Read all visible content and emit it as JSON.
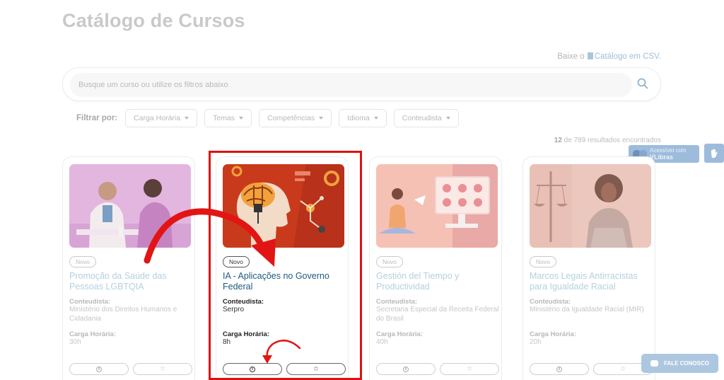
{
  "page": {
    "title": "Catálogo de Cursos"
  },
  "csv": {
    "prefix": "Baixe o",
    "link": "Catálogo em CSV."
  },
  "search": {
    "placeholder": "Busque um curso ou utilize os filtros abaixo"
  },
  "filters": {
    "label": "Filtrar por:",
    "items": [
      "Carga Horária",
      "Temas",
      "Competências",
      "Idioma",
      "Conteudista"
    ]
  },
  "results": {
    "shown": "12",
    "middle": "de 789 resultados encontrados"
  },
  "vlibras": {
    "line1": "Acessível com",
    "line2": "VLibras"
  },
  "courses": [
    {
      "badge": "Novo",
      "title": "Promoção da Saúde das Pessoas LGBTQIA",
      "author_label": "Conteudista:",
      "author": "Ministério dos Direitos Humanos e Cidadania",
      "hours_label": "Carga Horária:",
      "hours": "30h"
    },
    {
      "badge": "Novo",
      "title": "IA - Aplicações no Governo Federal",
      "author_label": "Conteudista:",
      "author": "Serpro",
      "hours_label": "Carga Horária:",
      "hours": "8h"
    },
    {
      "badge": "Novo",
      "title": "Gestión del Tiempo y Productividad",
      "author_label": "Conteudista:",
      "author": "Secretaria Especial da Receita Federal do Brasil",
      "hours_label": "Carga Horária:",
      "hours": "40h"
    },
    {
      "badge": "Novo",
      "title": "Marcos Legais Antirracistas para Igualdade Racial",
      "author_label": "Conteudista:",
      "author": "Ministério da Igualdade Racial (MIR)",
      "hours_label": "Carga Horária:",
      "hours": "20h"
    }
  ],
  "actions": {
    "info": "i",
    "favorite": "☆"
  },
  "fale": {
    "label": "FALE CONOSCO"
  },
  "colors": {
    "highlight": "#e01010",
    "title_link": "#1b5b7d",
    "accent": "#9dbcdc"
  },
  "icons": [
    "search-icon",
    "csv-file-icon",
    "info-icon",
    "star-icon",
    "chat-icon",
    "hand-icon"
  ]
}
